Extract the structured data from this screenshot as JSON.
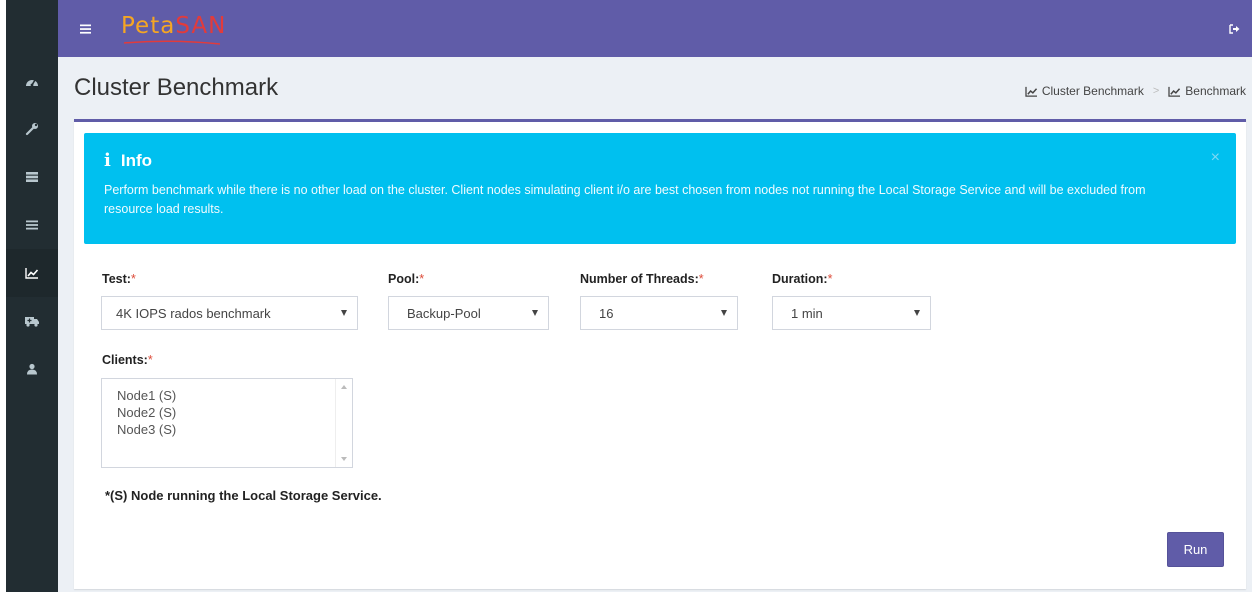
{
  "app": {
    "logo_text_1": "Peta",
    "logo_text_2": "SAN"
  },
  "sidebar": {
    "items": [
      {
        "icon": "dashboard-icon",
        "active": false
      },
      {
        "icon": "wrench-icon",
        "active": false
      },
      {
        "icon": "server-icon",
        "active": false
      },
      {
        "icon": "list-icon",
        "active": false
      },
      {
        "icon": "line-chart-icon",
        "active": true
      },
      {
        "icon": "ambulance-icon",
        "active": false
      },
      {
        "icon": "user-icon",
        "active": false
      }
    ]
  },
  "header": {
    "title": "Cluster Benchmark",
    "breadcrumb": [
      "Cluster Benchmark",
      "Benchmark"
    ],
    "breadcrumb_separator": ">"
  },
  "alert": {
    "icon": "i",
    "title": "Info",
    "message": "Perform benchmark while there is no other load on the cluster. Client nodes simulating client i/o are best chosen from nodes not running the Local Storage Service and will be excluded from resource load results.",
    "close": "×"
  },
  "form": {
    "required_mark": "*",
    "test": {
      "label": "Test:",
      "value": "4K IOPS rados benchmark"
    },
    "pool": {
      "label": "Pool:",
      "value": "Backup-Pool"
    },
    "threads": {
      "label": "Number of Threads:",
      "value": "16"
    },
    "duration": {
      "label": "Duration:",
      "value": "1 min"
    },
    "clients": {
      "label": "Clients:",
      "options": [
        "Node1 (S)",
        "Node2 (S)",
        "Node3 (S)"
      ]
    },
    "note": "*(S) Node running the Local Storage Service.",
    "run_label": "Run"
  },
  "colors": {
    "accent": "#605ca8",
    "sidebar": "#222d32",
    "info": "#00c0ef",
    "required": "#dd4b39"
  }
}
